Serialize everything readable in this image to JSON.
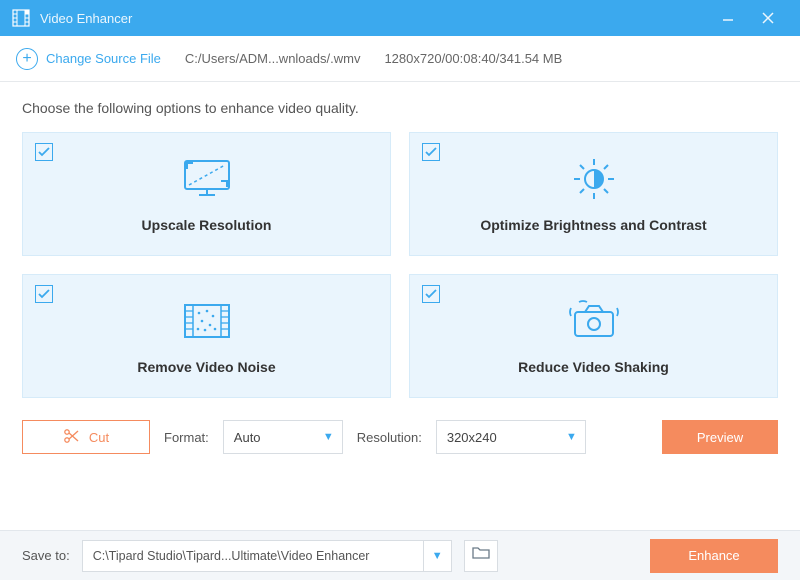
{
  "titlebar": {
    "title": "Video Enhancer"
  },
  "source": {
    "change_label": "Change Source File",
    "path": "C:/Users/ADM...wnloads/.wmv",
    "info": "1280x720/00:08:40/341.54 MB"
  },
  "instruction": "Choose the following options to enhance video quality.",
  "cards": [
    {
      "label": "Upscale Resolution",
      "checked": true
    },
    {
      "label": "Optimize Brightness and Contrast",
      "checked": true
    },
    {
      "label": "Remove Video Noise",
      "checked": true
    },
    {
      "label": "Reduce Video Shaking",
      "checked": true
    }
  ],
  "controls": {
    "cut_label": "Cut",
    "format_label": "Format:",
    "format_value": "Auto",
    "resolution_label": "Resolution:",
    "resolution_value": "320x240",
    "preview_label": "Preview"
  },
  "footer": {
    "saveto_label": "Save to:",
    "path": "C:\\Tipard Studio\\Tipard...Ultimate\\Video Enhancer",
    "enhance_label": "Enhance"
  }
}
